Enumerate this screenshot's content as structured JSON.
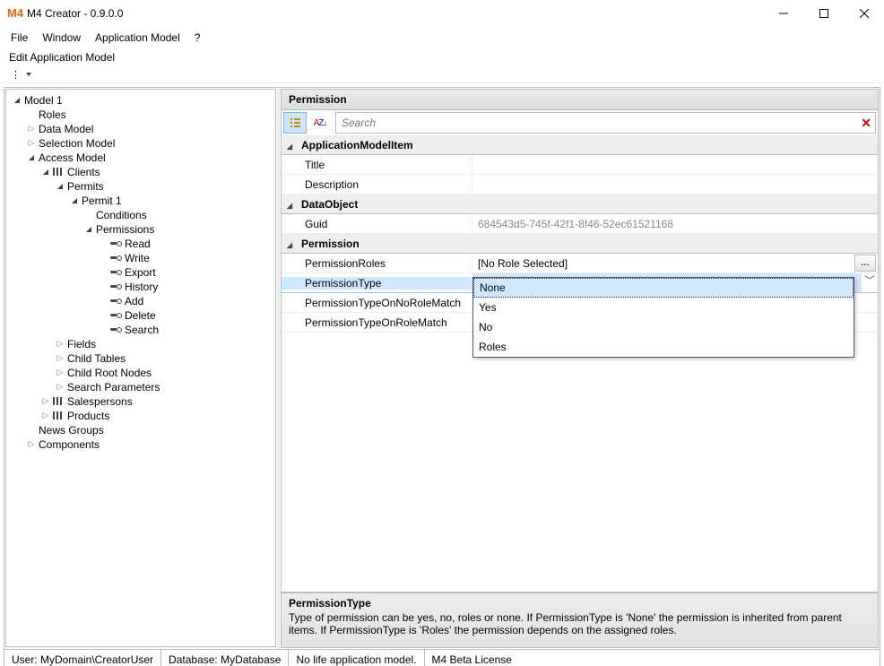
{
  "window": {
    "title": "M4 Creator - 0.9.0.0",
    "app_icon_text": "M4"
  },
  "menu": {
    "file": "File",
    "window": "Window",
    "appmodel": "Application Model",
    "help": "?"
  },
  "tabstrip": {
    "tab1": "Edit Application Model"
  },
  "tree": {
    "root": "Model 1",
    "roles": "Roles",
    "dataModel": "Data Model",
    "selectionModel": "Selection Model",
    "accessModel": "Access Model",
    "clients": "Clients",
    "permits": "Permits",
    "permit1": "Permit 1",
    "conditions": "Conditions",
    "permissions": "Permissions",
    "read": "Read",
    "write": "Write",
    "export": "Export",
    "history": "History",
    "add": "Add",
    "delete": "Delete",
    "search": "Search",
    "fields": "Fields",
    "childTables": "Child Tables",
    "childRootNodes": "Child Root Nodes",
    "searchParameters": "Search Parameters",
    "salespersons": "Salespersons",
    "products": "Products",
    "newsGroups": "News Groups",
    "components": "Components"
  },
  "props": {
    "panelTitle": "Permission",
    "searchPlaceholder": "Search",
    "cat1": "ApplicationModelItem",
    "title": "Title",
    "description": "Description",
    "cat2": "DataObject",
    "guid_label": "Guid",
    "guid_value": "684543d5-745f-42f1-8f46-52ec61521168",
    "cat3": "Permission",
    "permissionRoles_label": "PermissionRoles",
    "permissionRoles_value": "[No Role Selected]",
    "permissionType_label": "PermissionType",
    "permissionType_value": "None",
    "permissionTypeNoRole_label": "PermissionTypeOnNoRoleMatch",
    "permissionTypeRole_label": "PermissionTypeOnRoleMatch",
    "dropdown": {
      "opt1": "None",
      "opt2": "Yes",
      "opt3": "No",
      "opt4": "Roles"
    },
    "desc_name": "PermissionType",
    "desc_text": "Type of permission can be yes, no, roles or none. If PermissionType is 'None' the permission is inherited from parent items. If PermissionType is 'Roles' the permission depends on the assigned roles."
  },
  "status": {
    "user": "User: MyDomain\\CreatorUser",
    "database": "Database: MyDatabase",
    "life": "No life application model.",
    "license": "M4 Beta License"
  }
}
